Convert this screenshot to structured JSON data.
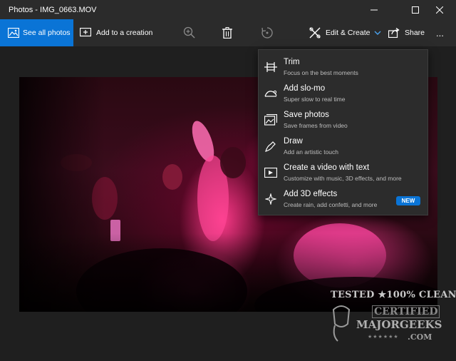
{
  "window": {
    "title": "Photos - IMG_0663.MOV"
  },
  "toolbar": {
    "see_all_label": "See all photos",
    "add_to_creation_label": "Add to a creation",
    "edit_create_label": "Edit & Create",
    "share_label": "Share",
    "more_label": "..."
  },
  "menu": {
    "items": [
      {
        "title": "Trim",
        "subtitle": "Focus on the best moments",
        "icon": "trim-icon"
      },
      {
        "title": "Add slo-mo",
        "subtitle": "Super slow to real time",
        "icon": "slo-mo-icon"
      },
      {
        "title": "Save photos",
        "subtitle": "Save frames from video",
        "icon": "save-photos-icon"
      },
      {
        "title": "Draw",
        "subtitle": "Add an artistic touch",
        "icon": "draw-icon"
      },
      {
        "title": "Create a video with text",
        "subtitle": "Customize with music, 3D effects, and more",
        "icon": "video-text-icon"
      },
      {
        "title": "Add 3D effects",
        "subtitle": "Create rain, add confetti, and more",
        "icon": "3d-effects-icon",
        "badge": "NEW"
      }
    ]
  },
  "watermark": {
    "line1": "TESTED ★100% CLEAN",
    "line2": "CERTIFIED",
    "line3": "MAJORGEEKS",
    "line4": ".COM",
    "stars": "★★★★★★"
  },
  "colors": {
    "accent": "#0a74d6",
    "background": "#2b2b2b",
    "menu_bg": "#2c2c2c"
  }
}
